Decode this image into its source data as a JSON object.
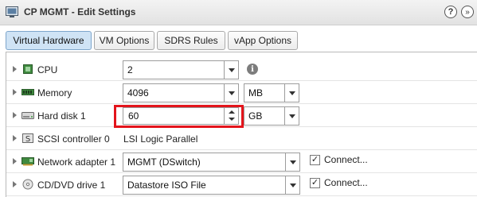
{
  "window": {
    "title": "CP MGMT - Edit Settings",
    "help_label": "?",
    "expand_label": "»"
  },
  "tabs": [
    {
      "label": "Virtual Hardware",
      "active": true
    },
    {
      "label": "VM Options",
      "active": false
    },
    {
      "label": "SDRS Rules",
      "active": false
    },
    {
      "label": "vApp Options",
      "active": false
    }
  ],
  "hardware": {
    "cpu": {
      "label": "CPU",
      "value": "2",
      "info_icon": "i"
    },
    "memory": {
      "label": "Memory",
      "value": "4096",
      "unit": "MB"
    },
    "hard_disk": {
      "label": "Hard disk 1",
      "value": "60",
      "unit": "GB"
    },
    "scsi": {
      "label": "SCSI controller 0",
      "value": "LSI Logic Parallel"
    },
    "network": {
      "label": "Network adapter 1",
      "value": "MGMT (DSwitch)",
      "connect_label": "Connect...",
      "connected": true
    },
    "cdrom": {
      "label": "CD/DVD drive 1",
      "value": "Datastore ISO File",
      "connect_label": "Connect...",
      "connected": true
    }
  },
  "icons": {
    "app": "vm-icon",
    "cpu": "cpu-chip-icon",
    "memory": "memory-module-icon",
    "hard_disk": "hard-disk-icon",
    "scsi": "scsi-controller-icon",
    "network": "network-card-icon",
    "cdrom": "cd-dvd-icon"
  },
  "colors": {
    "active_tab": "#cfe3f5",
    "highlight": "#e3141b"
  }
}
